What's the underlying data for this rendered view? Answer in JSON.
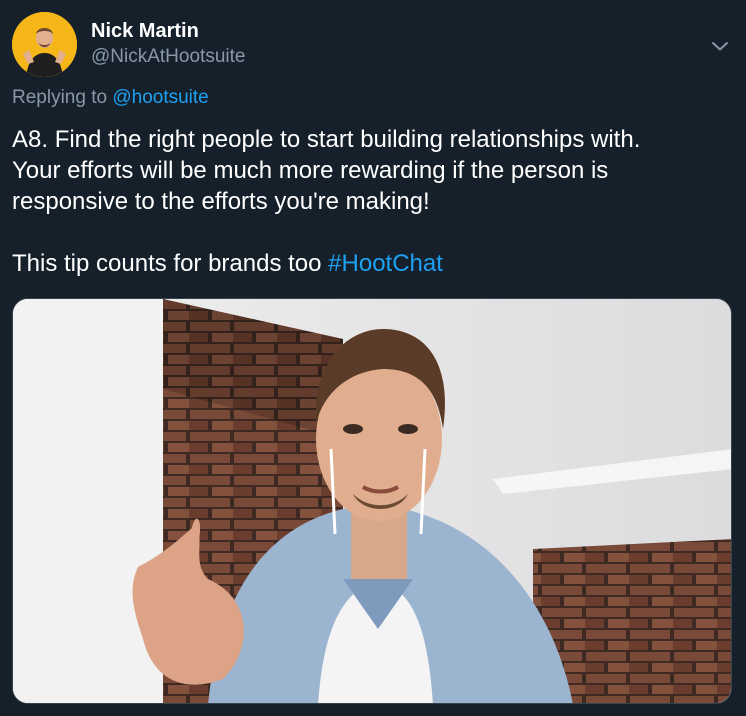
{
  "author": {
    "display_name": "Nick Martin",
    "handle": "@NickAtHootsuite",
    "avatar_icon": "profile-photo",
    "avatar_bg_color": "#f5b617"
  },
  "reply": {
    "prefix": "Replying to ",
    "mention": "@hootsuite"
  },
  "tweet": {
    "lines": [
      "A8. Find the right people to start building relationships with.",
      "Your efforts will be much more rewarding if the person is",
      "responsive to the efforts you're making!"
    ],
    "tip_prefix": "This tip counts for brands too ",
    "hashtag": "#HootChat"
  },
  "media": {
    "icon": "video-thumbnail-man-gesturing"
  },
  "menu": {
    "icon": "chevron-down-icon"
  },
  "colors": {
    "background": "#15202b",
    "text_primary": "#ffffff",
    "text_secondary": "#8899a6",
    "link": "#1da1f2",
    "border": "#38444d"
  }
}
